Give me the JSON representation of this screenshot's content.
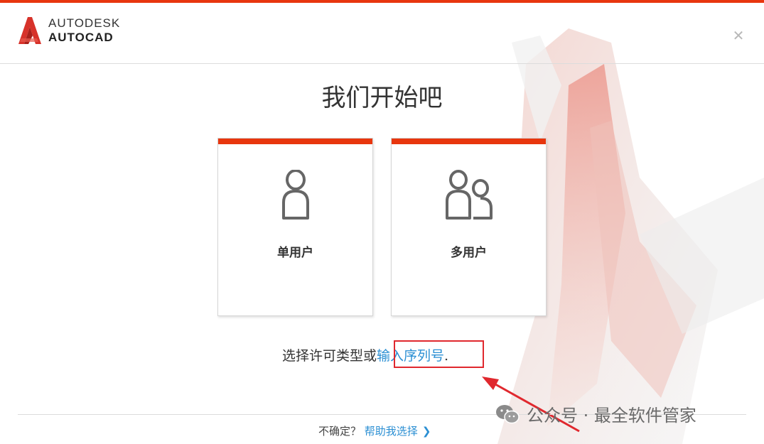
{
  "app": {
    "brand_line1": "AUTODESK",
    "brand_line2": "AUTOCAD",
    "close_symbol": "✕"
  },
  "main": {
    "title": "我们开始吧",
    "cards": [
      {
        "label": "单用户",
        "icon": "single-user-icon"
      },
      {
        "label": "多用户",
        "icon": "multi-user-icon"
      }
    ],
    "prompt_text": "选择许可类型或",
    "serial_link": "输入序列号",
    "prompt_period": "."
  },
  "footer": {
    "unsure": "不确定？",
    "help_link": "帮助我选择",
    "chevron": "❯"
  },
  "watermark": {
    "text": "公众号 · 最全软件管家",
    "icon": "wechat-icon"
  },
  "colors": {
    "accent": "#e8360e",
    "link": "#2b8fd3",
    "highlight": "#e0282e"
  }
}
